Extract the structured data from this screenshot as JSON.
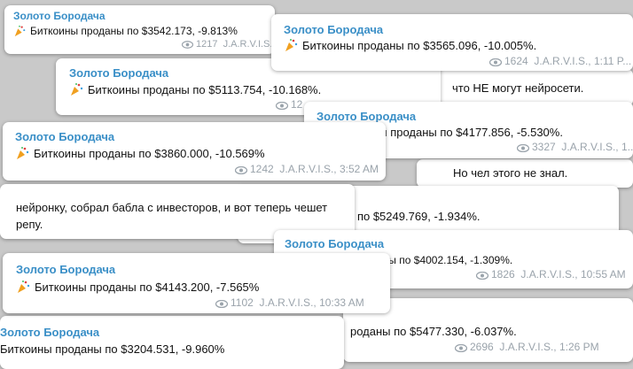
{
  "cards": [
    {
      "author": "Золото Бородача",
      "text": "Биткоины проданы по $3542.173, -9.813%",
      "views": "1217",
      "footer": "J.A.R.V.I.S., 9..."
    },
    {
      "author": "Золото Бородача",
      "text": "Биткоины проданы по $3565.096, -10.005%.",
      "views": "1624",
      "footer": "J.A.R.V.I.S., 1:11 P..."
    },
    {
      "author": "Золото Бородача",
      "text": "Биткоины проданы по $5113.754, -10.168%.",
      "views": "12",
      "footer": ""
    },
    {
      "author": "",
      "text": "что НЕ  могут нейросети.",
      "views": "",
      "footer": ""
    },
    {
      "author": "Золото Бородача",
      "text": "Биткоины проданы по $4177.856, -5.530%.",
      "views": "3327",
      "footer": "J.A.R.V.I.S., 1..."
    },
    {
      "author": "Золото Бородача",
      "text": "Биткоины проданы по $3860.000, -10.569%",
      "views": "1242",
      "footer": "J.A.R.V.I.S., 3:52 AM"
    },
    {
      "author": "",
      "text": "Но чел этого не знал.",
      "views": "",
      "footer": ""
    },
    {
      "author": "",
      "text": "нейронку, собрал бабла с инвесторов, и вот теперь чешет",
      "text2": "репу.",
      "views": "",
      "footer": ""
    },
    {
      "author": "",
      "text": "даны по $5249.769, -1.934%.",
      "views": "",
      "footer": ""
    },
    {
      "author": "Золото Бородача",
      "text": "Биткоины проданы по $4002.154, -1.309%.",
      "views": "1826",
      "footer": "J.A.R.V.I.S., 10:55 AM"
    },
    {
      "author": "Золото Бородача",
      "text": "Биткоины проданы по $4143.200, -7.565%",
      "views": "1102",
      "footer": "J.A.R.V.I.S., 10:33 AM"
    },
    {
      "author": "",
      "text": "роданы по $5477.330, -6.037%.",
      "views": "2696",
      "footer": "J.A.R.V.I.S., 1:26 PM"
    },
    {
      "author": "Золото Бородача",
      "text": "Биткоины проданы по $3204.531, -9.960%",
      "views": "",
      "footer": ""
    }
  ]
}
